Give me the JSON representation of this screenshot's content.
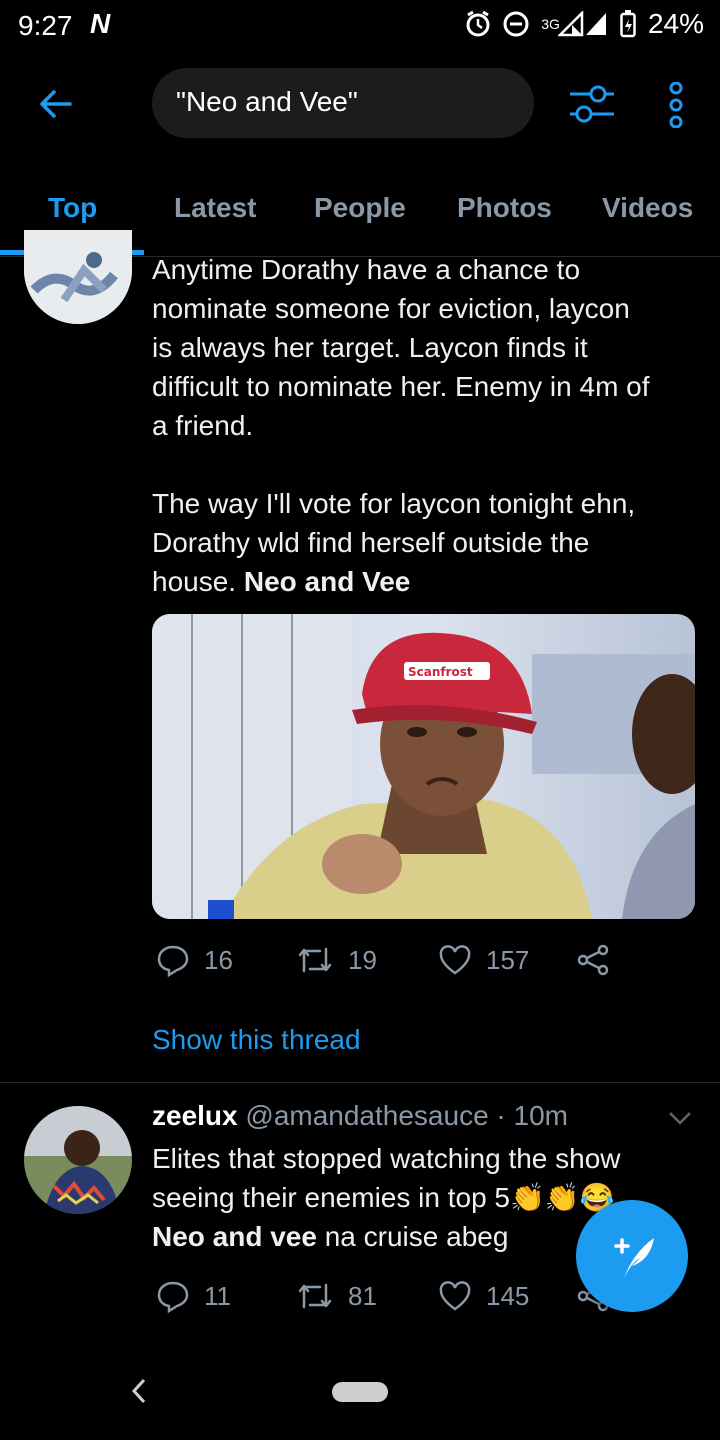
{
  "status_bar": {
    "time": "9:27",
    "carrier_glyph": "N",
    "network": "3G",
    "battery": "24%"
  },
  "header": {
    "search_query": "\"Neo and Vee\""
  },
  "tabs": [
    {
      "label": "Top",
      "active": true
    },
    {
      "label": "Latest",
      "active": false
    },
    {
      "label": "People",
      "active": false
    },
    {
      "label": "Photos",
      "active": false
    },
    {
      "label": "Videos",
      "active": false
    }
  ],
  "tweet1": {
    "lines": [
      "Anytime Dorathy have a chance to",
      "nominate someone for eviction, laycon",
      "is always her target. Laycon finds it",
      "difficult to nominate her. Enemy in 4m of",
      "a friend."
    ],
    "lines2_start": "The way I'll vote for laycon tonight ehn,",
    "lines2_mid": "Dorathy wld find herself outside the",
    "lines2_end_plain": "house. ",
    "lines2_end_bold": "Neo and Vee",
    "media_cap_text": "Scanfrost",
    "replies": "16",
    "retweets": "19",
    "likes": "157",
    "show_thread": "Show this thread"
  },
  "tweet2": {
    "name": "zeelux",
    "handle": "@amandathesauce",
    "time": "· 10m",
    "line1": "Elites that stopped watching the show",
    "line2": "seeing their enemies in top 5👏👏😂",
    "line3_bold": "Neo and vee",
    "line3_plain": " na cruise abeg",
    "replies": "11",
    "retweets": "81",
    "likes": "145"
  },
  "colors": {
    "accent": "#1d9bf0",
    "muted": "#8b98a5",
    "background": "#000000"
  },
  "icons": [
    "back-arrow-icon",
    "filter-icon",
    "more-vert-icon",
    "reply-icon",
    "retweet-icon",
    "like-icon",
    "share-icon",
    "compose-icon",
    "caret-down-icon"
  ]
}
